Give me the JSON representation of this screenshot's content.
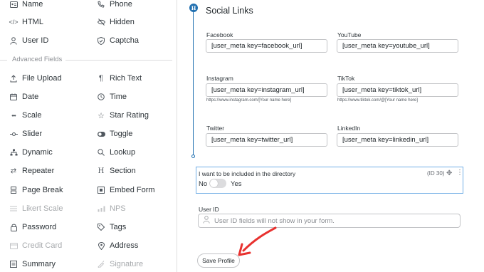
{
  "sidebar": {
    "col1": [
      {
        "label": "Name",
        "icon": "id-card-icon",
        "disabled": false
      },
      {
        "label": "HTML",
        "icon": "code-icon",
        "disabled": false
      },
      {
        "label": "User ID",
        "icon": "user-icon",
        "disabled": false
      },
      {
        "label": "File Upload",
        "icon": "upload-icon",
        "disabled": false
      },
      {
        "label": "Date",
        "icon": "calendar-icon",
        "disabled": false
      },
      {
        "label": "Scale",
        "icon": "scale-icon",
        "disabled": false
      },
      {
        "label": "Slider",
        "icon": "slider-icon",
        "disabled": false
      },
      {
        "label": "Dynamic",
        "icon": "sitemap-icon",
        "disabled": false
      },
      {
        "label": "Repeater",
        "icon": "repeat-icon",
        "disabled": false
      },
      {
        "label": "Page Break",
        "icon": "page-break-icon",
        "disabled": false
      },
      {
        "label": "Likert Scale",
        "icon": "likert-icon",
        "disabled": true
      },
      {
        "label": "Password",
        "icon": "lock-icon",
        "disabled": false
      },
      {
        "label": "Credit Card",
        "icon": "credit-card-icon",
        "disabled": true
      },
      {
        "label": "Summary",
        "icon": "summary-icon",
        "disabled": false
      }
    ],
    "col2": [
      {
        "label": "Phone",
        "icon": "phone-icon",
        "disabled": false
      },
      {
        "label": "Hidden",
        "icon": "eye-slash-icon",
        "disabled": false
      },
      {
        "label": "Captcha",
        "icon": "shield-icon",
        "disabled": false
      },
      {
        "label": "Rich Text",
        "icon": "paragraph-icon",
        "disabled": false
      },
      {
        "label": "Time",
        "icon": "clock-icon",
        "disabled": false
      },
      {
        "label": "Star Rating",
        "icon": "star-icon",
        "disabled": false
      },
      {
        "label": "Toggle",
        "icon": "toggle-icon",
        "disabled": false
      },
      {
        "label": "Lookup",
        "icon": "search-icon",
        "disabled": false
      },
      {
        "label": "Section",
        "icon": "heading-icon",
        "disabled": false
      },
      {
        "label": "Embed Form",
        "icon": "embed-icon",
        "disabled": false
      },
      {
        "label": "NPS",
        "icon": "nps-icon",
        "disabled": true
      },
      {
        "label": "Tags",
        "icon": "tag-icon",
        "disabled": false
      },
      {
        "label": "Address",
        "icon": "map-marker-icon",
        "disabled": false
      },
      {
        "label": "Signature",
        "icon": "signature-icon",
        "disabled": true
      }
    ],
    "advanced_heading": "Advanced Fields"
  },
  "section": {
    "badge": "H",
    "title": "Social Links"
  },
  "fields": [
    {
      "label": "Facebook",
      "value": "[user_meta key=facebook_url]",
      "help": ""
    },
    {
      "label": "YouTube",
      "value": "[user_meta key=youtube_url]",
      "help": ""
    },
    {
      "label": "Instagram",
      "value": "[user_meta key=instagram_url]",
      "help": "https://www.instagram.com/[Your name here]"
    },
    {
      "label": "TikTok",
      "value": "[user_meta key=tiktok_url]",
      "help": "https://www.tiktok.com/@[Your name here]"
    },
    {
      "label": "Twitter",
      "value": "[user_meta key=twitter_url]",
      "help": ""
    },
    {
      "label": "LinkedIn",
      "value": "[user_meta key=linkedin_url]",
      "help": ""
    }
  ],
  "directory": {
    "label": "I want to be included in the directory",
    "id_text": "(ID 30)",
    "no": "No",
    "yes": "Yes",
    "checked": false
  },
  "user_id": {
    "label": "User ID",
    "placeholder": "User ID fields will not show in your form."
  },
  "save_button": "Save Profile",
  "colors": {
    "accent": "#2271b1",
    "arrow": "#e8312f"
  }
}
